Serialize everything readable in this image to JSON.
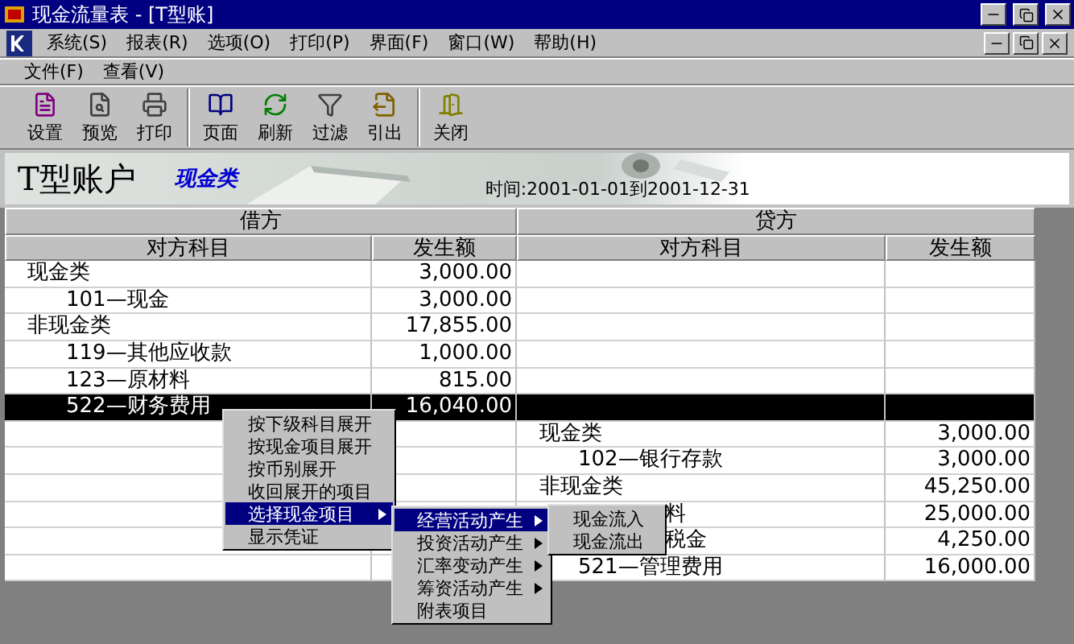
{
  "window": {
    "title": "现金流量表 - [T型账]"
  },
  "menu_bar": [
    "系统(S)",
    "报表(R)",
    "选项(O)",
    "打印(P)",
    "界面(F)",
    "窗口(W)",
    "帮助(H)"
  ],
  "sub_menu_bar": [
    "文件(F)",
    "查看(V)"
  ],
  "toolbar": [
    [
      "设置",
      "预览",
      "打印"
    ],
    [
      "页面",
      "刷新",
      "过滤",
      "引出"
    ],
    [
      "关闭"
    ]
  ],
  "banner": {
    "title": "T型账户",
    "subtitle": "现金类",
    "period": "时间:2001-01-01到2001-12-31"
  },
  "table": {
    "debit": {
      "heading": "借方",
      "columns": [
        "对方科目",
        "发生额"
      ],
      "rows": [
        {
          "label": "现金类",
          "amount": "3,000.00",
          "selected": false,
          "children": [
            {
              "label": "101—现金",
              "amount": "3,000.00",
              "selected": false
            }
          ]
        },
        {
          "label": "非现金类",
          "amount": "17,855.00",
          "selected": false,
          "children": [
            {
              "label": "119—其他应收款",
              "amount": "1,000.00",
              "selected": false
            },
            {
              "label": "123—原材料",
              "amount": "815.00",
              "selected": false
            },
            {
              "label": "522—财务费用",
              "amount": "16,040.00",
              "selected": true
            }
          ]
        }
      ]
    },
    "credit": {
      "heading": "贷方",
      "columns": [
        "对方科目",
        "发生额"
      ],
      "rows": [
        {
          "label": "现金类",
          "amount": "3,000.00",
          "selected": false,
          "children": [
            {
              "label": "102—银行存款",
              "amount": "3,000.00",
              "selected": false
            }
          ]
        },
        {
          "label": "非现金类",
          "amount": "45,250.00",
          "selected": false,
          "children": [
            {
              "label": "料",
              "clipped": true,
              "amount": "25,000.00",
              "selected": false
            },
            {
              "label": "税金",
              "clipped": true,
              "amount": "4,250.00",
              "selected": false
            },
            {
              "label": "521—管理费用",
              "amount": "16,000.00",
              "selected": false
            }
          ]
        }
      ]
    }
  },
  "context_menu": [
    {
      "label": "按下级科目展开",
      "selected": false
    },
    {
      "label": "按现金项目展开",
      "selected": false
    },
    {
      "label": "按币别展开",
      "selected": false
    },
    {
      "label": "收回展开的项目",
      "selected": false
    },
    {
      "label": "选择现金项目",
      "selected": true,
      "submenu": true
    },
    {
      "label": "显示凭证",
      "selected": false
    }
  ],
  "submenu": [
    {
      "label": "经营活动产生",
      "selected": true,
      "submenu": true
    },
    {
      "label": "投资活动产生",
      "selected": false,
      "submenu": true
    },
    {
      "label": "汇率变动产生",
      "selected": false,
      "submenu": true
    },
    {
      "label": "筹资活动产生",
      "selected": false,
      "submenu": true
    },
    {
      "label": "附表项目",
      "selected": false
    }
  ],
  "submenu_2": [
    {
      "label": "现金流入",
      "selected": false
    },
    {
      "label": "现金流出",
      "selected": false
    }
  ]
}
